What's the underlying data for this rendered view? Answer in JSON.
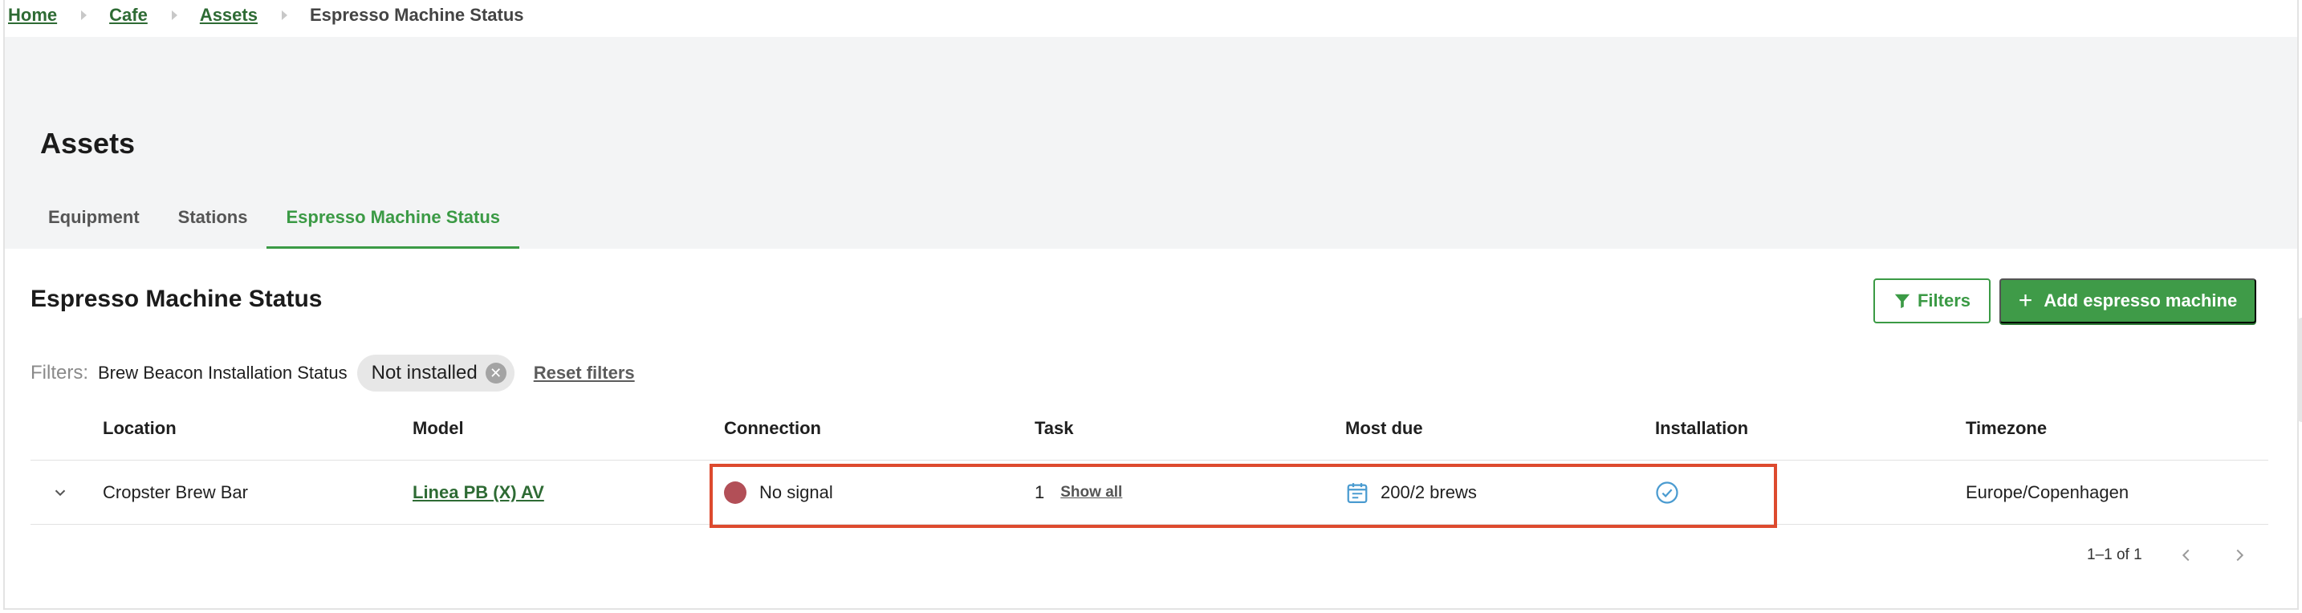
{
  "breadcrumb": {
    "items": [
      {
        "label": "Home"
      },
      {
        "label": "Cafe"
      },
      {
        "label": "Assets"
      }
    ],
    "current": "Espresso Machine Status"
  },
  "header": {
    "title": "Assets",
    "tabs": [
      {
        "label": "Equipment",
        "active": false
      },
      {
        "label": "Stations",
        "active": false
      },
      {
        "label": "Espresso Machine Status",
        "active": true
      }
    ]
  },
  "section": {
    "title": "Espresso Machine Status",
    "filters_button": "Filters",
    "add_button": "Add espresso machine"
  },
  "filters": {
    "label": "Filters:",
    "name": "Brew Beacon Installation Status",
    "chip_value": "Not installed",
    "reset_label": "Reset filters"
  },
  "table": {
    "columns": [
      "Location",
      "Model",
      "Connection",
      "Task",
      "Most due",
      "Installation",
      "Timezone"
    ],
    "rows": [
      {
        "location": "Cropster Brew Bar",
        "model": "Linea PB (X) AV",
        "connection": "No signal",
        "task_count": "1",
        "task_link": "Show all",
        "most_due": "200/2 brews",
        "installation_icon": "check-circle-icon",
        "timezone": "Europe/Copenhagen"
      }
    ]
  },
  "pagination": {
    "range": "1–1 of 1"
  },
  "colors": {
    "accent": "#3b9a45",
    "link": "#2e6b34",
    "status_no_signal": "#b24f57",
    "highlight": "#dd4a2e"
  }
}
